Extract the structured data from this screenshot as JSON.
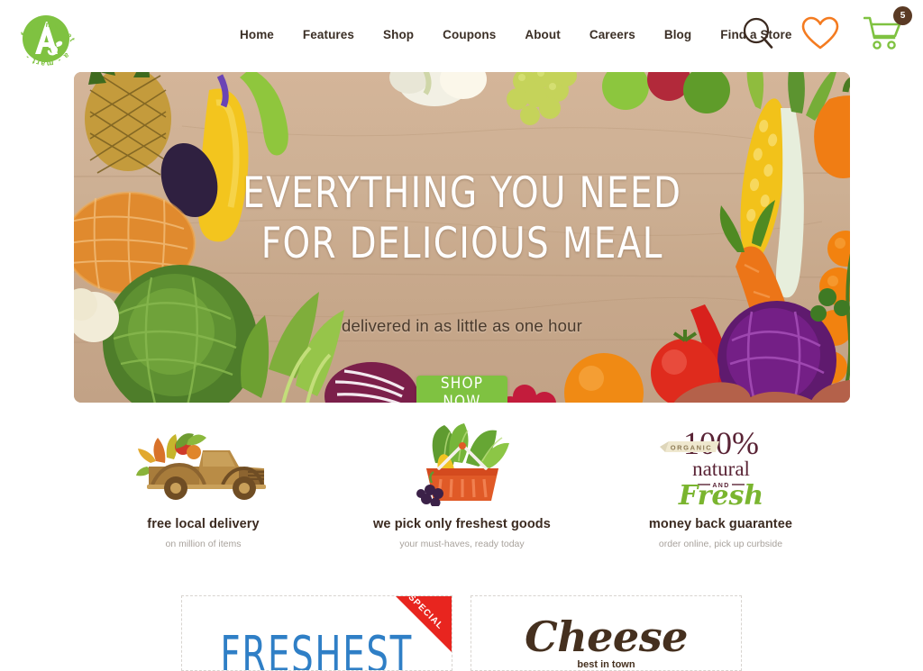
{
  "header": {
    "logo": {
      "brand_letter": "A",
      "ring_text_top": "food market",
      "ring_text_bottom": "a - mart",
      "color": "#7fc241"
    },
    "nav": [
      {
        "label": "Home"
      },
      {
        "label": "Features"
      },
      {
        "label": "Shop"
      },
      {
        "label": "Coupons"
      },
      {
        "label": "About"
      },
      {
        "label": "Careers"
      },
      {
        "label": "Blog"
      },
      {
        "label": "Find a Store"
      }
    ],
    "actions": {
      "search_icon": "search-icon",
      "wishlist_icon": "heart-icon",
      "cart_icon": "shopping-cart-icon",
      "cart_count": "5",
      "search_color": "#3b2a20",
      "wishlist_color": "#f47b20",
      "cart_color": "#7fc241",
      "badge_color": "#5a3a24"
    }
  },
  "hero": {
    "title_line1": "EVERYTHING YOU NEED",
    "title_line2": "FOR DELICIOUS MEAL",
    "subtitle": "delivered in as little as one hour",
    "cta_label": "SHOP NOW",
    "cta_color": "#7fc241",
    "background": "photo of fresh vegetables and fruit framing a wooden cutting board"
  },
  "features": [
    {
      "icon": "delivery-truck-icon",
      "title": "free local delivery",
      "subtitle": "on million of items"
    },
    {
      "icon": "grocery-basket-icon",
      "title": "we pick only freshest goods",
      "subtitle": "your must-haves, ready today"
    },
    {
      "icon": "natural-fresh-badge-icon",
      "title": "money back guarantee",
      "subtitle": "order online, pick up curbside",
      "badge_percent": "100%",
      "badge_organic": "ORGANIC",
      "badge_natural": "natural",
      "badge_and": "AND",
      "badge_fresh": "Fresh"
    }
  ],
  "coupons": [
    {
      "ribbon_label": "SPECIAL",
      "ribbon_color": "#e8251f",
      "title": "FRESHEST",
      "title_color": "#2f7fc6"
    },
    {
      "title": "Cheese",
      "subtitle": "best in town",
      "title_color": "#45301f"
    }
  ]
}
